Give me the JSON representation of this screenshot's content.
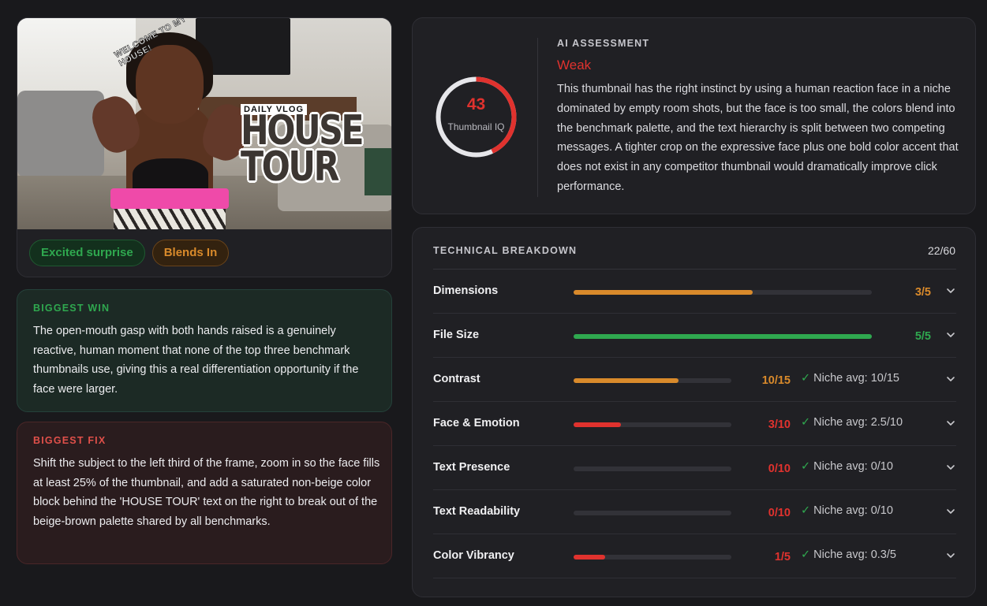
{
  "thumbnail": {
    "overlay_welcome": "WELCOME TO MY HOUSE!",
    "overlay_daily": "DAILY VLOG",
    "overlay_title_line1": "HOUSE",
    "overlay_title_line2": "TOUR"
  },
  "tags": [
    {
      "label": "Excited surprise",
      "color": "#2fa84f"
    },
    {
      "label": "Blends In",
      "color": "#d98a2b"
    }
  ],
  "biggest_win": {
    "title": "BIGGEST WIN",
    "text": "The open-mouth gasp with both hands raised is a genuinely reactive, human moment that none of the top three benchmark thumbnails use, giving this a real differentiation opportunity if the face were larger."
  },
  "biggest_fix": {
    "title": "BIGGEST FIX",
    "text": "Shift the subject to the left third of the frame, zoom in so the face fills at least 25% of the thumbnail, and add a saturated non-beige color block behind the 'HOUSE TOUR' text on the right to break out of the beige-brown palette shared by all benchmarks."
  },
  "assessment": {
    "title": "AI ASSESSMENT",
    "score": "43",
    "score_value": 43,
    "score_max": 100,
    "score_label": "Thumbnail IQ",
    "verdict": "Weak",
    "text": "This thumbnail has the right instinct by using a human reaction face in a niche dominated by empty room shots, but the face is too small, the colors blend into the benchmark palette, and the text hierarchy is split between two competing messages. A tighter crop on the expressive face plus one bold color accent that does not exist in any competitor thumbnail would dramatically improve click performance."
  },
  "breakdown": {
    "title": "TECHNICAL BREAKDOWN",
    "total": "22/60",
    "rows": [
      {
        "label": "Dimensions",
        "score": 3,
        "max": 5,
        "value": "3/5",
        "color": "#d98a2b",
        "avg": ""
      },
      {
        "label": "File Size",
        "score": 5,
        "max": 5,
        "value": "5/5",
        "color": "#2fa84f",
        "avg": ""
      },
      {
        "label": "Contrast",
        "score": 10,
        "max": 15,
        "value": "10/15",
        "color": "#d98a2b",
        "avg": "Niche avg: 10/15"
      },
      {
        "label": "Face & Emotion",
        "score": 3,
        "max": 10,
        "value": "3/10",
        "color": "#e0322e",
        "avg": "Niche avg: 2.5/10"
      },
      {
        "label": "Text Presence",
        "score": 0,
        "max": 10,
        "value": "0/10",
        "color": "#e0322e",
        "avg": "Niche avg: 0/10"
      },
      {
        "label": "Text Readability",
        "score": 0,
        "max": 10,
        "value": "0/10",
        "color": "#e0322e",
        "avg": "Niche avg: 0/10"
      },
      {
        "label": "Color Vibrancy",
        "score": 1,
        "max": 5,
        "value": "1/5",
        "color": "#e0322e",
        "avg": "Niche avg: 0.3/5"
      }
    ]
  }
}
